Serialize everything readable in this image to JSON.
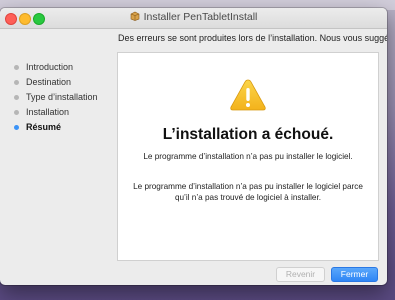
{
  "window": {
    "title": "Installer PenTabletInstall"
  },
  "subtitle": "Des erreurs se sont produites lors de l’installation. Nous vous suggé",
  "sidebar": {
    "steps": [
      {
        "label": "Introduction",
        "active": false
      },
      {
        "label": "Destination",
        "active": false
      },
      {
        "label": "Type d’installation",
        "active": false
      },
      {
        "label": "Installation",
        "active": false
      },
      {
        "label": "Résumé",
        "active": true
      }
    ]
  },
  "main": {
    "headline": "L’installation a échoué.",
    "message1": "Le programme d’installation n’a pas pu installer le logiciel.",
    "message2": "Le programme d’installation n’a pas pu installer le logiciel parce qu’il n’a pas trouvé de logiciel à installer."
  },
  "buttons": {
    "back": "Revenir",
    "close": "Fermer"
  },
  "colors": {
    "accent": "#3b93f7",
    "warning": "#f6c12b"
  },
  "icons": {
    "warning": "warning-triangle-icon",
    "package": "package-icon"
  }
}
